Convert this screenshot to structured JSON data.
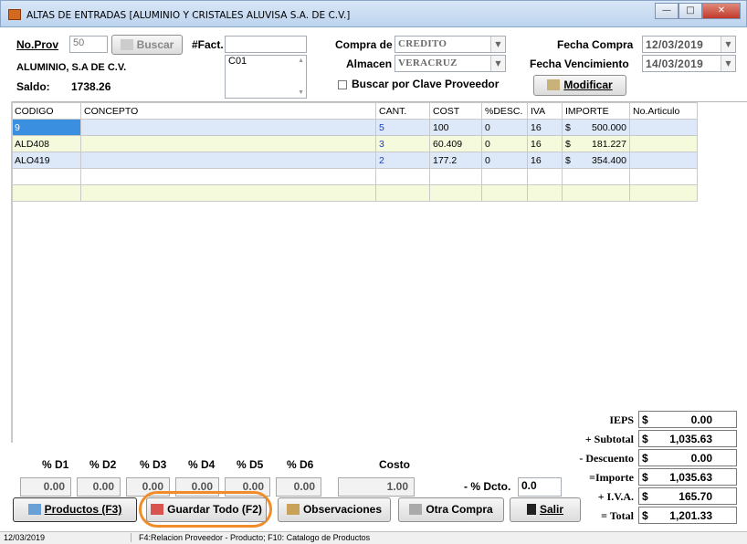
{
  "window": {
    "title": "ALTAS DE ENTRADAS [ALUMINIO Y CRISTALES ALUVISA S.A. DE C.V.]"
  },
  "header": {
    "no_prov_label": "No.Prov",
    "no_prov_value": "50",
    "buscar_label": "Buscar",
    "proveedor_name": "ALUMINIO, S.A DE C.V.",
    "saldo_label": "Saldo:",
    "saldo_value": "1738.26",
    "fact_label": "#Fact.",
    "fact_value": "",
    "memo_value": "C01",
    "compra_de_label": "Compra de",
    "compra_de_value": "CREDITO",
    "almacen_label": "Almacen",
    "almacen_value": "VERACRUZ",
    "buscar_clave_label": "Buscar por Clave Proveedor",
    "fecha_compra_label": "Fecha Compra",
    "fecha_compra_value": "12/03/2019",
    "fecha_venc_label": "Fecha Vencimiento",
    "fecha_venc_value": "14/03/2019",
    "modificar_label": "Modificar"
  },
  "grid": {
    "columns": [
      "CODIGO",
      "CONCEPTO",
      "CANT.",
      "COST",
      "%DESC.",
      "IVA",
      "IMPORTE",
      "No.Articulo"
    ],
    "rows": [
      {
        "codigo": "9",
        "concepto": "",
        "cant": "5",
        "cost": "100",
        "desc": "0",
        "iva": "16",
        "cur": "$",
        "importe": "500.000",
        "articulo": ""
      },
      {
        "codigo": "ALD408",
        "concepto": "",
        "cant": "3",
        "cost": "60.409",
        "desc": "0",
        "iva": "16",
        "cur": "$",
        "importe": "181.227",
        "articulo": ""
      },
      {
        "codigo": "ALO419",
        "concepto": "",
        "cant": "2",
        "cost": "177.2",
        "desc": "0",
        "iva": "16",
        "cur": "$",
        "importe": "354.400",
        "articulo": ""
      }
    ]
  },
  "discounts": {
    "labels": [
      "% D1",
      "% D2",
      "% D3",
      "% D4",
      "% D5",
      "% D6"
    ],
    "values": [
      "0.00",
      "0.00",
      "0.00",
      "0.00",
      "0.00",
      "0.00"
    ],
    "costo_label": "Costo",
    "costo_value": "1.00",
    "dcto_label": "- % Dcto.",
    "dcto_value": "0.0"
  },
  "totals": {
    "ieps_label": "IEPS",
    "ieps_value": "0.00",
    "subtotal_label": "+ Subtotal",
    "subtotal_value": "1,035.63",
    "descuento_label": "- Descuento",
    "descuento_value": "0.00",
    "importe_label": "=Importe",
    "importe_value": "1,035.63",
    "iva_label": "+ I.V.A.",
    "iva_value": "165.70",
    "total_label": "= Total",
    "total_value": "1,201.33",
    "currency": "$"
  },
  "buttons": {
    "productos": "Productos (F3)",
    "guardar": "Guardar Todo  (F2)",
    "observaciones": "Observaciones",
    "otra_compra": "Otra Compra",
    "salir": "Salir"
  },
  "status": {
    "date": "12/03/2019",
    "hint": "F4:Relacion Proveedor - Producto; F10: Catalogo de Productos"
  },
  "colors": {
    "highlight_ring": "#f28c28",
    "selected_cell": "#3b8fe0",
    "row_blue": "#dde9f8",
    "row_yellow": "#f6fadc"
  }
}
